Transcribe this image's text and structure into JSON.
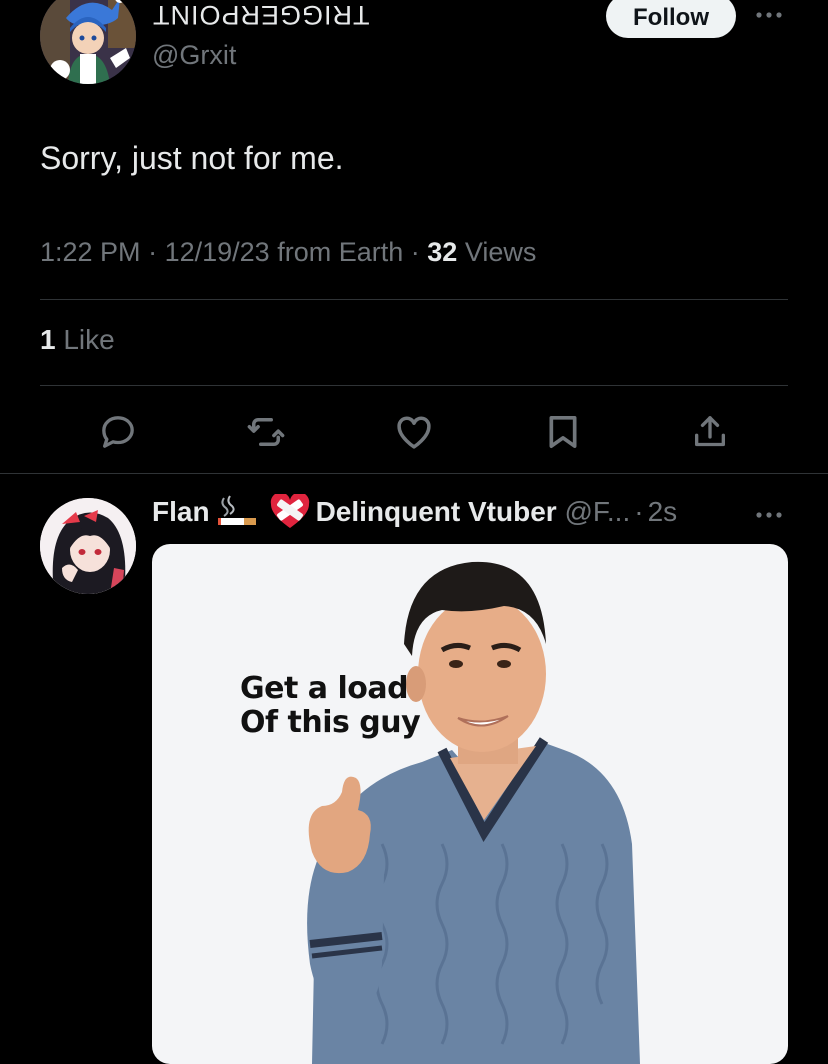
{
  "tweet": {
    "display_name": "TRIGGERPOINT",
    "handle": "@Grxit",
    "follow_label": "Follow",
    "text": "Sorry, just not for me.",
    "time": "1:22 PM",
    "date_location": "12/19/23 from Earth",
    "sep1": "·",
    "sep2": "·",
    "views_count": "32",
    "views_label": "Views",
    "likes_count": "1",
    "likes_label": "Like"
  },
  "actions": [
    {
      "icon": "reply-icon"
    },
    {
      "icon": "retweet-icon"
    },
    {
      "icon": "like-icon"
    },
    {
      "icon": "bookmark-icon"
    },
    {
      "icon": "share-icon"
    }
  ],
  "reply": {
    "name_part1": "Flan",
    "name_part2": "Delinquent Vtuber",
    "handle": "@F...",
    "sep": "·",
    "time": "2s",
    "emojis": [
      "cigarette-emoji",
      "mending-heart-emoji"
    ],
    "media": {
      "caption_line1": "Get a load",
      "caption_line2": "Of this guy"
    }
  },
  "colors": {
    "background": "#000000",
    "text_primary": "#e7e9ea",
    "text_secondary": "#71767b",
    "divider": "#2f3336",
    "follow_bg": "#eff3f4"
  }
}
